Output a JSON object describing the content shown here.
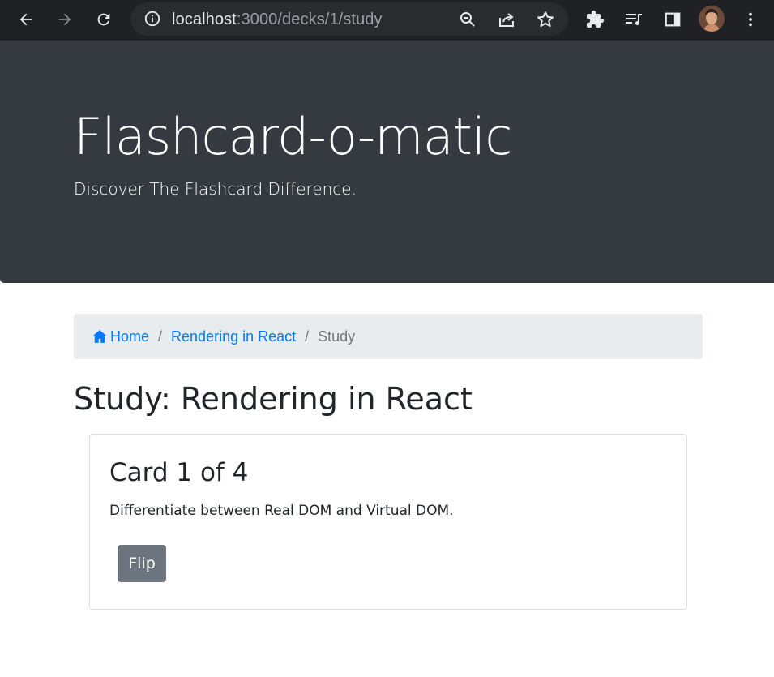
{
  "browser": {
    "url_host": "localhost",
    "url_rest": ":3000/decks/1/study",
    "icons": [
      "back-icon",
      "forward-icon",
      "reload-icon",
      "site-info-icon",
      "zoom-icon",
      "share-icon",
      "bookmark-star-icon",
      "extensions-icon",
      "media-control-icon",
      "side-panel-icon",
      "profile-avatar",
      "menu-icon"
    ]
  },
  "jumbotron": {
    "title": "Flashcard-o-matic",
    "subtitle": "Discover The Flashcard Difference."
  },
  "breadcrumb": {
    "home": "Home",
    "deck": "Rendering in React",
    "current": "Study",
    "separator": "/"
  },
  "page": {
    "title": "Study: Rendering in React"
  },
  "card": {
    "title": "Card 1 of 4",
    "front": "Differentiate between Real DOM and Virtual DOM.",
    "flip_label": "Flip"
  },
  "colors": {
    "jumbotron_bg": "#343a40",
    "link": "#007bff",
    "breadcrumb_bg": "#e9ecef",
    "button_secondary": "#6c757d"
  }
}
